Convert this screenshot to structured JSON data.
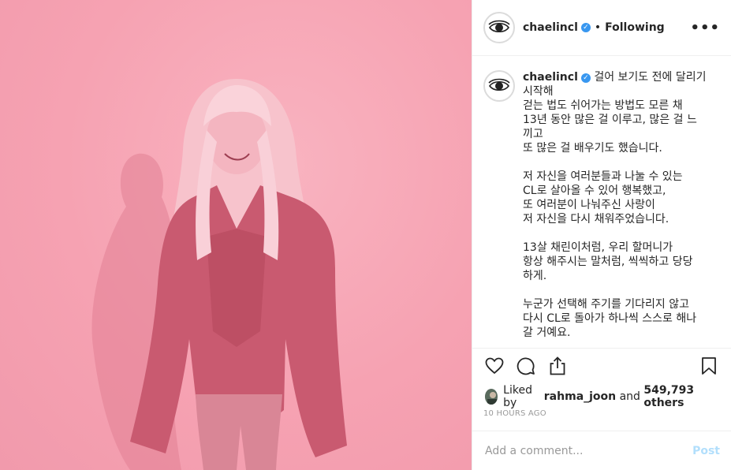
{
  "post": {
    "username": "chaelincl",
    "verified_icon": "verified-badge-icon",
    "separator": "•",
    "follow_state": "Following",
    "more_label": "•••",
    "accent_color": "#3897f0",
    "photo_tint": "#f7a8b6"
  },
  "caption": {
    "username": "chaelincl",
    "lines": [
      "걸어 보기도 전에 달리기",
      "시작해",
      "걷는 법도 쉬어가는 방법도 모른 채",
      "13년 동안 많은 걸 이루고, 많은 걸 느",
      "끼고",
      "또 많은 걸 배우기도 했습니다.",
      "",
      "저 자신을 여러분들과 나눌 수 있는",
      "CL로 살아올 수 있어 행복했고,",
      "또 여러분이 나눠주신 사랑이",
      "저 자신을 다시 채워주었습니다.",
      "",
      "13살 채린이처럼, 우리 할머니가",
      "항상 해주시는 말처럼, 씩씩하고 당당",
      "하게.",
      "",
      "누군가 선택해 주기를 기다리지 않고",
      "다시 CL로 돌아가 하나씩 스스로 해나",
      "갈 거예요."
    ]
  },
  "actions": {
    "like_icon": "heart-icon",
    "comment_icon": "comment-icon",
    "share_icon": "share-icon",
    "save_icon": "bookmark-icon"
  },
  "likes": {
    "prefix": "Liked by",
    "user": "rahma_joon",
    "joiner": "and",
    "count": "549,793 others"
  },
  "timestamp": "10 HOURS AGO",
  "add_comment": {
    "placeholder": "Add a comment...",
    "post_label": "Post"
  }
}
